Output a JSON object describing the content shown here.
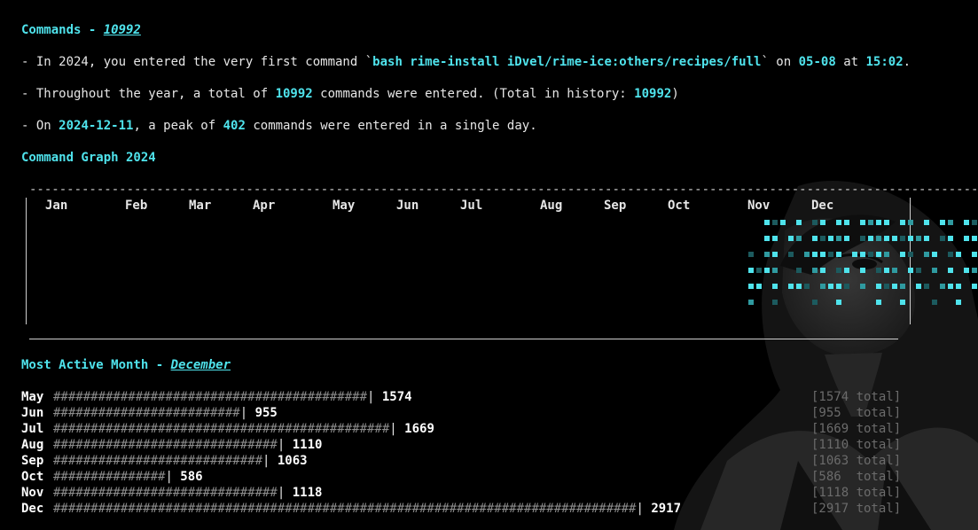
{
  "commands": {
    "label": "Commands - ",
    "count": "10992"
  },
  "first_command": {
    "prefix": "- In 2024, you entered the very first command `",
    "command": "bash rime-install iDvel/rime-ice:others/recipes/full",
    "mid": "` on ",
    "date": "05-08",
    "at": " at ",
    "time": "15:02",
    "end": "."
  },
  "totals": {
    "prefix": "- Throughout the year, a total of ",
    "count": "10992",
    "mid": " commands were entered. (Total in history: ",
    "history": "10992",
    "end": ")"
  },
  "peak": {
    "prefix": "- On ",
    "date": "2024-12-11",
    "mid": ", a peak of ",
    "count": "402",
    "end": " commands were entered in a single day."
  },
  "graph": {
    "title": "Command Graph 2024",
    "months": [
      "Jan",
      "Feb",
      "Mar",
      "Apr",
      "May",
      "Jun",
      "Jul",
      "Aug",
      "Sep",
      "Oct",
      "Nov",
      "Dec"
    ],
    "colors": {
      "high": "#4fe3ec",
      "mid": "#2f9aa0",
      "low": "#1c5a5e"
    },
    "cells": [
      "......................................................###.#.##.##.####.##.#.##.##.#...#.....##.#.##.####.",
      "......................................................##.##.#####.#########.##.##.#..#.###.####.######..",
      "....................................................#.##.#.#####.#####.##.##.##.###.#..###.###.####.##..",
      "....................................................####..#.##.##.#.###.##.#.#.##.#..##.#.####.###.##...",
      "....................................................##.#.###.####.#.####.##.###.##.#..##.#.##.######.#...",
      "....................................................#..#....#..#....#..#...#..#..#.....##.##.#.#.#.#.#...",
      "......................................................................................#................."
    ]
  },
  "most_active": {
    "label": "Most Active Month - ",
    "month": "December"
  },
  "bars": [
    {
      "month": "May",
      "hashes": 42,
      "count": "1574",
      "total": "[1574 total]"
    },
    {
      "month": "Jun",
      "hashes": 25,
      "count": "955",
      "total": "[955  total]"
    },
    {
      "month": "Jul",
      "hashes": 45,
      "count": "1669",
      "total": "[1669 total]"
    },
    {
      "month": "Aug",
      "hashes": 30,
      "count": "1110",
      "total": "[1110 total]"
    },
    {
      "month": "Sep",
      "hashes": 28,
      "count": "1063",
      "total": "[1063 total]"
    },
    {
      "month": "Oct",
      "hashes": 15,
      "count": "586",
      "total": "[586  total]"
    },
    {
      "month": "Nov",
      "hashes": 30,
      "count": "1118",
      "total": "[1118 total]"
    },
    {
      "month": "Dec",
      "hashes": 78,
      "count": "2917",
      "total": "[2917 total]"
    }
  ]
}
